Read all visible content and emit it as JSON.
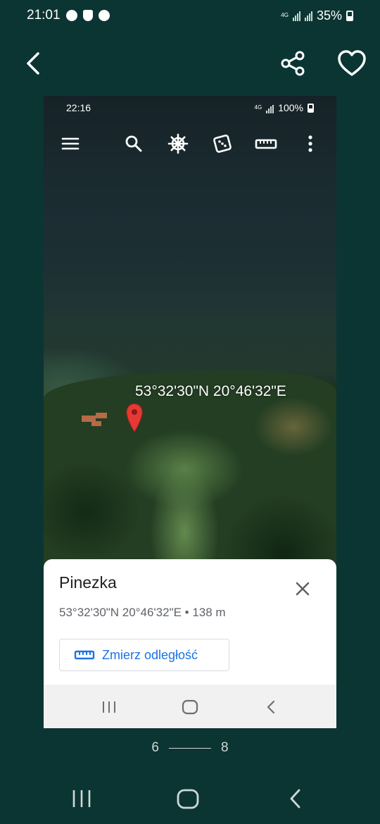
{
  "status_bar": {
    "time": "21:01",
    "battery": "35%",
    "network": "4G"
  },
  "inner": {
    "status": {
      "time": "22:16",
      "battery": "100%",
      "network": "4G"
    },
    "coord_label": "53°32'30\"N 20°46'32\"E",
    "sheet": {
      "title": "Pinezka",
      "subtitle": "53°32'30\"N 20°46'32\"E • 138 m",
      "measure_label": "Zmierz odległość"
    }
  },
  "pager": {
    "current": "6",
    "total": "8"
  },
  "colors": {
    "background": "#0b3532",
    "accent": "#1a73e8",
    "pin": "#e53935"
  },
  "icons": [
    "back-icon",
    "share-icon",
    "heart-icon",
    "menu-icon",
    "search-icon",
    "ship-wheel-icon",
    "dice-icon",
    "ruler-icon",
    "more-vert-icon",
    "close-icon"
  ]
}
